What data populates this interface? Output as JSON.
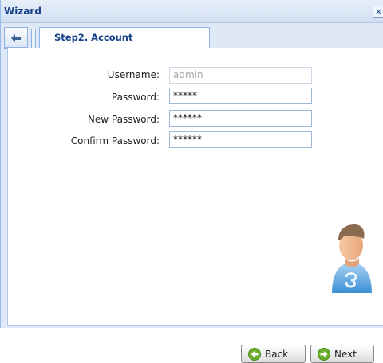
{
  "window": {
    "title": "Wizard",
    "close_glyph": "×"
  },
  "tab": {
    "back_glyph": "🡐",
    "label": "Step2. Account"
  },
  "form": {
    "username": {
      "label": "Username:",
      "value": "admin"
    },
    "password": {
      "label": "Password:",
      "value": "*****"
    },
    "new_password": {
      "label": "New Password:",
      "value": "******"
    },
    "confirm_password": {
      "label": "Confirm Password:",
      "value": "******"
    }
  },
  "buttons": {
    "back": "Back",
    "next": "Next"
  },
  "colors": {
    "accent": "#15428b",
    "button_icon_green": "#6aae2b"
  },
  "icons": {
    "avatar": "user-avatar-icon",
    "back": "back-arrow-icon",
    "next": "forward-arrow-icon"
  }
}
